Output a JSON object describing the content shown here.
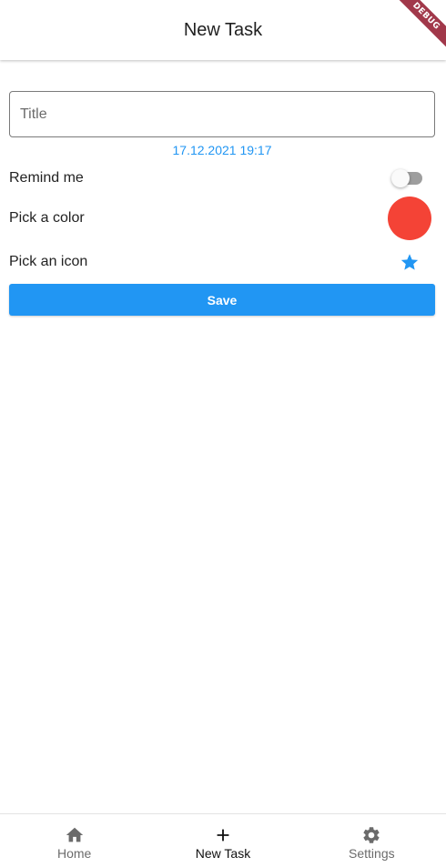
{
  "app_bar": {
    "title": "New Task",
    "debug_label": "DEBUG"
  },
  "form": {
    "title_placeholder": "Title",
    "title_value": "",
    "date_time": "17.12.2021 19:17",
    "remind_label": "Remind me",
    "remind_on": false,
    "color_label": "Pick a color",
    "selected_color": "#f44336",
    "icon_label": "Pick an icon",
    "selected_icon": "star-icon",
    "save_label": "Save"
  },
  "bottom_nav": {
    "items": [
      {
        "label": "Home",
        "icon": "home-icon",
        "active": false
      },
      {
        "label": "New Task",
        "icon": "plus-icon",
        "active": true
      },
      {
        "label": "Settings",
        "icon": "gear-icon",
        "active": false
      }
    ]
  },
  "colors": {
    "accent": "#2196f3",
    "picked_color": "#f44336",
    "debug_ribbon": "#a1384a"
  }
}
